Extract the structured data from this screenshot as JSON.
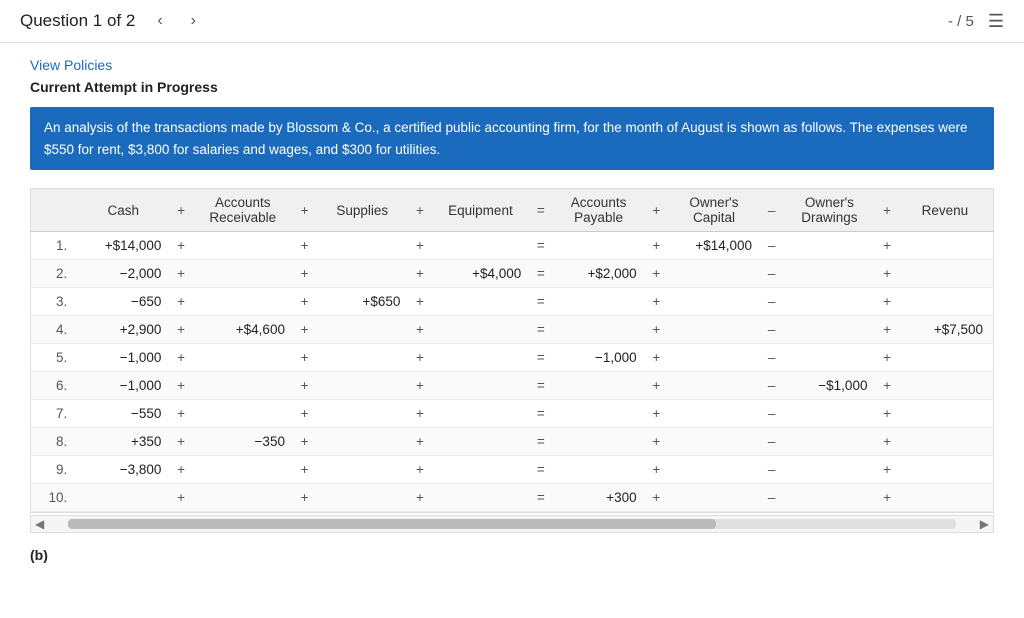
{
  "header": {
    "question_label": "Question 1 of 2",
    "prev_arrow": "‹",
    "next_arrow": "›",
    "score": "- / 5",
    "list_icon": "☰"
  },
  "links": {
    "view_policies": "View Policies"
  },
  "section": {
    "current_attempt": "Current Attempt in Progress",
    "description": "An analysis of the transactions made by Blossom & Co., a certified public accounting firm, for the month of August is shown as follows. The expenses were $550 for rent, $3,800 for salaries and wages, and $300 for utilities."
  },
  "table": {
    "columns": [
      {
        "label": "",
        "key": "num"
      },
      {
        "label": "Cash",
        "key": "cash"
      },
      {
        "label": "+",
        "key": "op1",
        "type": "op"
      },
      {
        "label": "Accounts\nReceivable",
        "key": "ar"
      },
      {
        "label": "+",
        "key": "op2",
        "type": "op"
      },
      {
        "label": "Supplies",
        "key": "supplies"
      },
      {
        "label": "+",
        "key": "op3",
        "type": "op"
      },
      {
        "label": "Equipment",
        "key": "equipment"
      },
      {
        "label": "=",
        "key": "op4",
        "type": "op"
      },
      {
        "label": "Accounts\nPayable",
        "key": "ap"
      },
      {
        "label": "+",
        "key": "op5",
        "type": "op"
      },
      {
        "label": "Owner's\nCapital",
        "key": "oc"
      },
      {
        "label": "–",
        "key": "op6",
        "type": "op"
      },
      {
        "label": "Owner's\nDrawings",
        "key": "od"
      },
      {
        "label": "+",
        "key": "op7",
        "type": "op"
      },
      {
        "label": "Revenue",
        "key": "revenue"
      }
    ],
    "rows": [
      {
        "num": "1.",
        "cash": "+$14,000",
        "ar": "",
        "supplies": "",
        "equipment": "",
        "ap": "",
        "oc": "+$14,000",
        "od": "",
        "revenue": ""
      },
      {
        "num": "2.",
        "cash": "−2,000",
        "ar": "",
        "supplies": "",
        "equipment": "+$4,000",
        "ap": "+$2,000",
        "oc": "",
        "od": "",
        "revenue": ""
      },
      {
        "num": "3.",
        "cash": "−650",
        "ar": "",
        "supplies": "+$650",
        "equipment": "",
        "ap": "",
        "oc": "",
        "od": "",
        "revenue": ""
      },
      {
        "num": "4.",
        "cash": "+2,900",
        "ar": "+$4,600",
        "supplies": "",
        "equipment": "",
        "ap": "",
        "oc": "",
        "od": "",
        "revenue": "+$7,500"
      },
      {
        "num": "5.",
        "cash": "−1,000",
        "ar": "",
        "supplies": "",
        "equipment": "",
        "ap": "−1,000",
        "oc": "",
        "od": "",
        "revenue": ""
      },
      {
        "num": "6.",
        "cash": "−1,000",
        "ar": "",
        "supplies": "",
        "equipment": "",
        "ap": "",
        "oc": "",
        "od": "−$1,000",
        "revenue": ""
      },
      {
        "num": "7.",
        "cash": "−550",
        "ar": "",
        "supplies": "",
        "equipment": "",
        "ap": "",
        "oc": "",
        "od": "",
        "revenue": ""
      },
      {
        "num": "8.",
        "cash": "+350",
        "ar": "−350",
        "supplies": "",
        "equipment": "",
        "ap": "",
        "oc": "",
        "od": "",
        "revenue": ""
      },
      {
        "num": "9.",
        "cash": "−3,800",
        "ar": "",
        "supplies": "",
        "equipment": "",
        "ap": "",
        "oc": "",
        "od": "",
        "revenue": ""
      },
      {
        "num": "10.",
        "cash": "",
        "ar": "",
        "supplies": "",
        "equipment": "",
        "ap": "+300",
        "oc": "",
        "od": "",
        "revenue": ""
      }
    ]
  },
  "footer": {
    "label": "(b)"
  }
}
